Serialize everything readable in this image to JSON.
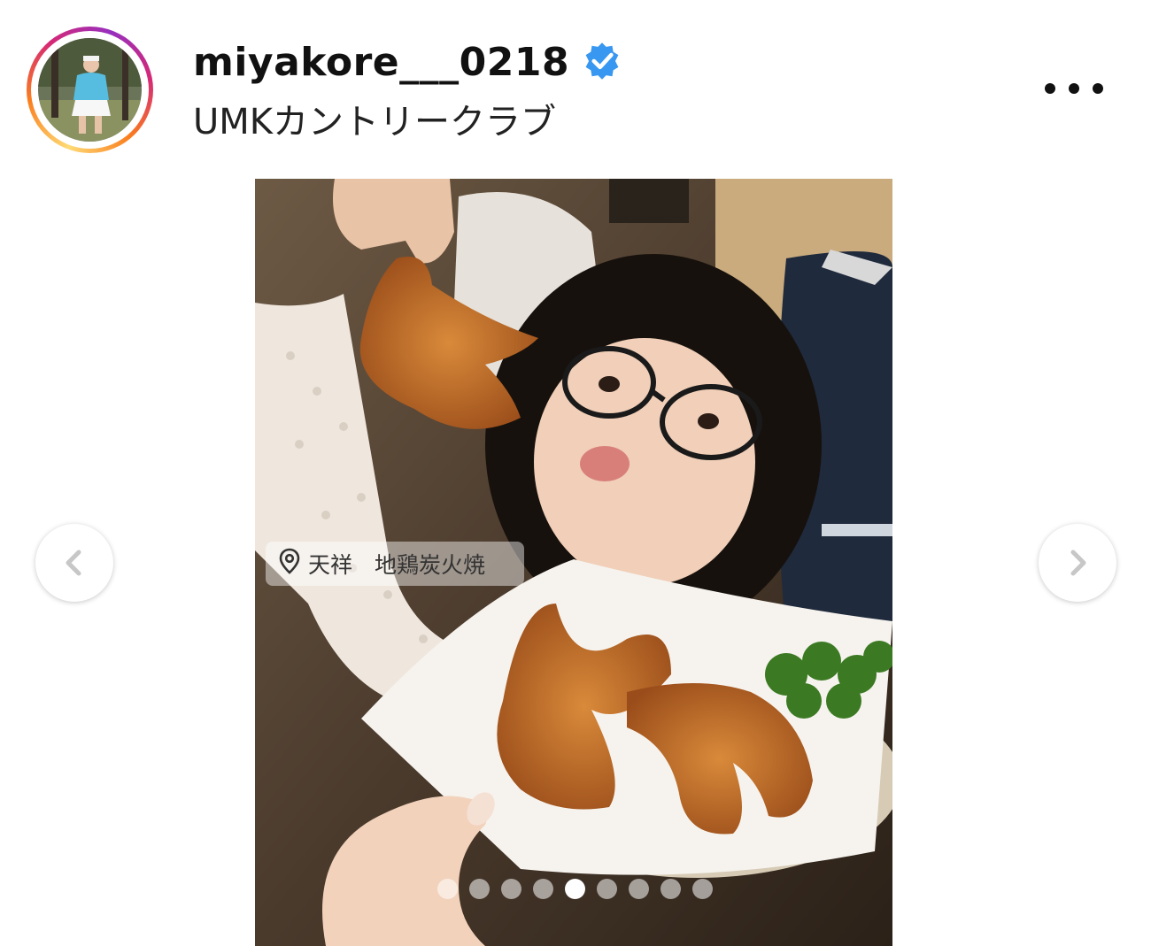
{
  "post": {
    "username": "miyakore___0218",
    "verified": true,
    "location_line": "UMKカントリークラブ",
    "more_icon": "more-horizontal-icon",
    "location_tag": "天祥　地鶏炭火焼",
    "carousel": {
      "total": 9,
      "active_index": 4
    }
  },
  "colors": {
    "verified": "#3897f0",
    "ring_gradient": [
      "#feda75",
      "#fa7e1e",
      "#d62976",
      "#962fbf"
    ]
  }
}
